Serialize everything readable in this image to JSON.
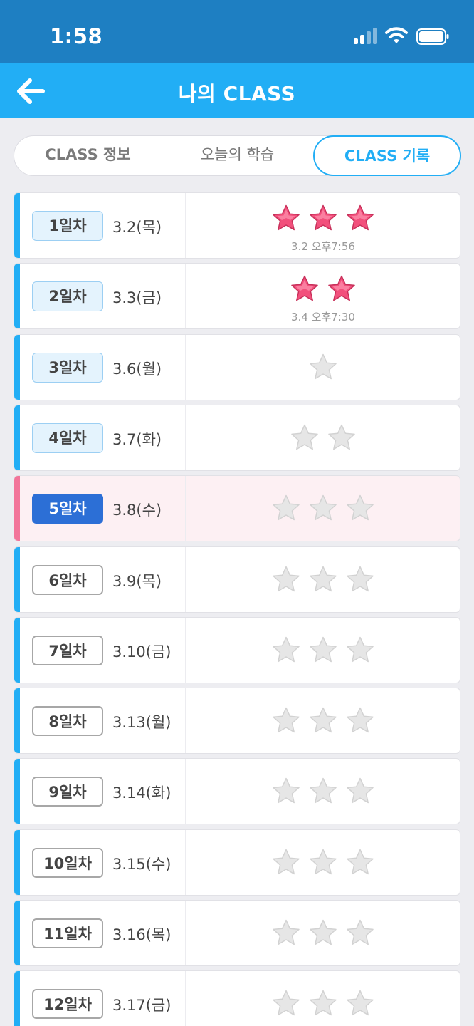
{
  "status_bar": {
    "time": "1:58"
  },
  "header": {
    "title": "나의 CLASS"
  },
  "tabs": [
    {
      "label": "CLASS 정보",
      "active": false
    },
    {
      "label": "오늘의 학습",
      "active": false
    },
    {
      "label": "CLASS 기록",
      "active": true
    }
  ],
  "colors": {
    "accent": "#22aef5",
    "header": "#22aef5",
    "status_bar": "#1e7fc2",
    "today_badge": "#2c6fd6",
    "earned_star": "#f2507c",
    "empty_star": "#e6e6e6",
    "current_row_bar": "#f2759a"
  },
  "days": [
    {
      "day": "1일차",
      "date": "3.2(목)",
      "state": "done",
      "stars_earned": 3,
      "stars_total": 3,
      "completed_at": "3.2 오후7:56"
    },
    {
      "day": "2일차",
      "date": "3.3(금)",
      "state": "done",
      "stars_earned": 2,
      "stars_total": 2,
      "completed_at": "3.4 오후7:30"
    },
    {
      "day": "3일차",
      "date": "3.6(월)",
      "state": "done",
      "stars_earned": 0,
      "stars_total": 1,
      "completed_at": ""
    },
    {
      "day": "4일차",
      "date": "3.7(화)",
      "state": "done",
      "stars_earned": 0,
      "stars_total": 2,
      "completed_at": ""
    },
    {
      "day": "5일차",
      "date": "3.8(수)",
      "state": "today",
      "stars_earned": 0,
      "stars_total": 3,
      "completed_at": ""
    },
    {
      "day": "6일차",
      "date": "3.9(목)",
      "state": "future",
      "stars_earned": 0,
      "stars_total": 3,
      "completed_at": ""
    },
    {
      "day": "7일차",
      "date": "3.10(금)",
      "state": "future",
      "stars_earned": 0,
      "stars_total": 3,
      "completed_at": ""
    },
    {
      "day": "8일차",
      "date": "3.13(월)",
      "state": "future",
      "stars_earned": 0,
      "stars_total": 3,
      "completed_at": ""
    },
    {
      "day": "9일차",
      "date": "3.14(화)",
      "state": "future",
      "stars_earned": 0,
      "stars_total": 3,
      "completed_at": ""
    },
    {
      "day": "10일차",
      "date": "3.15(수)",
      "state": "future",
      "stars_earned": 0,
      "stars_total": 3,
      "completed_at": ""
    },
    {
      "day": "11일차",
      "date": "3.16(목)",
      "state": "future",
      "stars_earned": 0,
      "stars_total": 3,
      "completed_at": ""
    },
    {
      "day": "12일차",
      "date": "3.17(금)",
      "state": "future",
      "stars_earned": 0,
      "stars_total": 3,
      "completed_at": ""
    }
  ]
}
